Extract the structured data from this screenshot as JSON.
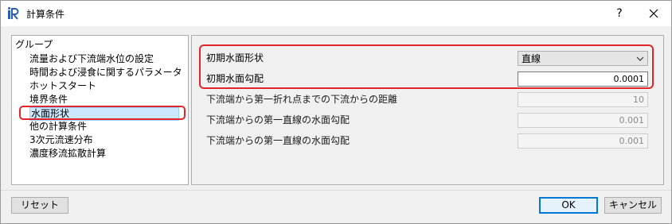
{
  "window": {
    "title": "計算条件",
    "help_label": "?",
    "logo_text": "iR"
  },
  "tree": {
    "header": "グループ",
    "items": [
      {
        "label": "流量および下流端水位の設定",
        "selected": false
      },
      {
        "label": "時間および浸食に関するパラメータ",
        "selected": false
      },
      {
        "label": "ホットスタート",
        "selected": false
      },
      {
        "label": "境界条件",
        "selected": false
      },
      {
        "label": "水面形状",
        "selected": true
      },
      {
        "label": "他の計算条件",
        "selected": false
      },
      {
        "label": "3次元流速分布",
        "selected": false
      },
      {
        "label": "濃度移流拡散計算",
        "selected": false
      }
    ]
  },
  "form": {
    "rows": [
      {
        "label": "初期水面形状",
        "type": "combo",
        "value": "直線",
        "enabled": true
      },
      {
        "label": "初期水面勾配",
        "type": "text",
        "value": "0.0001",
        "enabled": true
      },
      {
        "label": "下流端から第一折れ点までの下流からの距離",
        "type": "text",
        "value": "10",
        "enabled": false
      },
      {
        "label": "下流端からの第一直線の水面勾配",
        "type": "text",
        "value": "0.001",
        "enabled": false
      },
      {
        "label": "下流端からの第一直線の水面勾配",
        "type": "text",
        "value": "0.001",
        "enabled": false
      }
    ]
  },
  "buttons": {
    "reset": "リセット",
    "ok": "OK",
    "cancel": "キャンセル"
  },
  "colors": {
    "highlight_ring": "#e3242b",
    "selection_bg": "#cce8ff",
    "default_button_border": "#0078d7"
  }
}
